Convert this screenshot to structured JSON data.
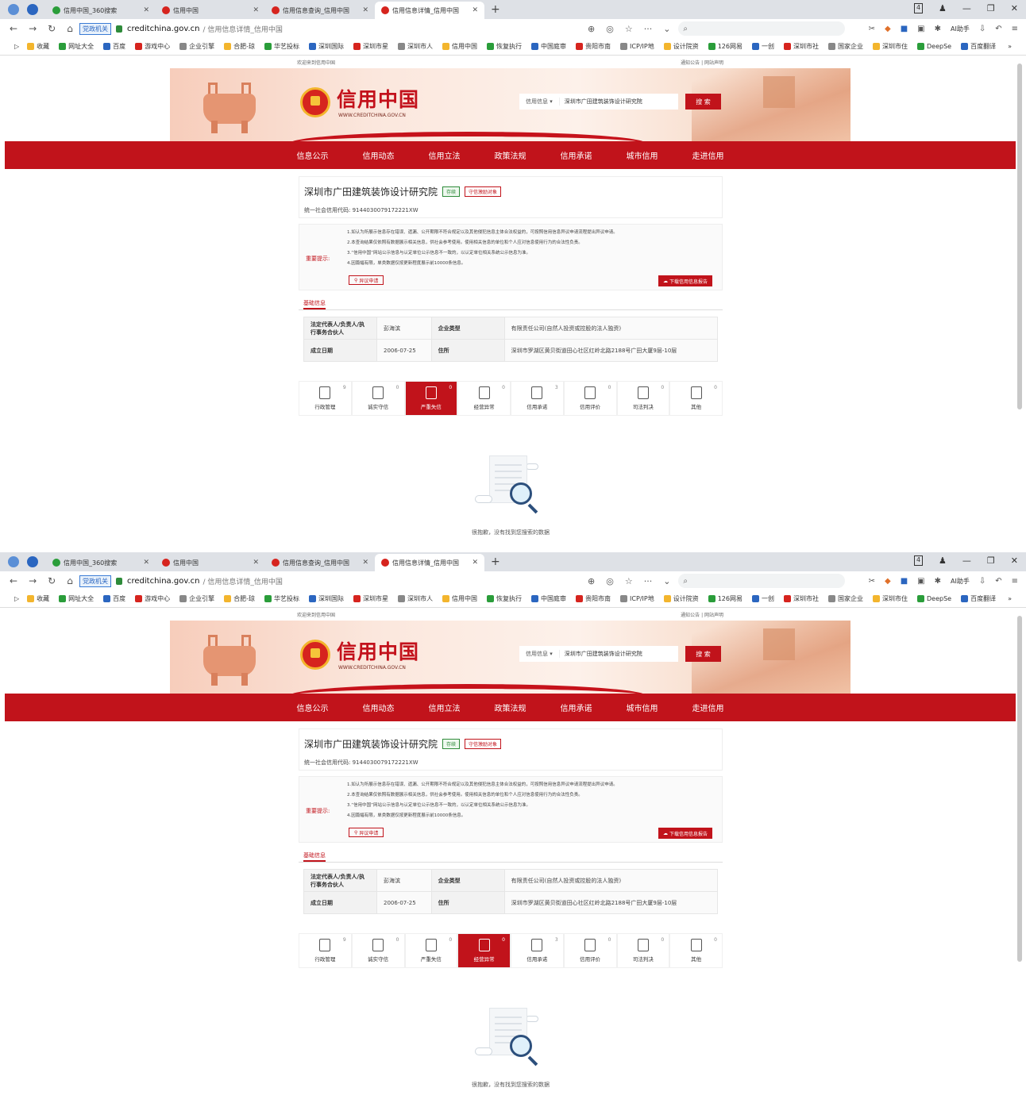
{
  "browser": {
    "tabs": [
      {
        "label": "信用中国_360搜索",
        "icon_color": "#2a9d3a",
        "active": false
      },
      {
        "label": "信用中国",
        "icon_color": "#d6241e",
        "active": false
      },
      {
        "label": "信用信息查询_信用中国",
        "icon_color": "#d6241e",
        "active": false
      },
      {
        "label": "信用信息详情_信用中国",
        "icon_color": "#d6241e",
        "active": true
      }
    ],
    "new_tab": "+",
    "tab_count_badge": "4",
    "address": {
      "badge": "党政机关",
      "host": "creditchina.gov.cn",
      "path": "/ 信用信息详情_信用中国"
    },
    "ai_assistant": "AI助手",
    "bookmarks": [
      "收藏",
      "网址大全",
      "百度",
      "游戏中心",
      "企业引擎",
      "合肥-琼",
      "华艺投标",
      "深圳国际",
      "深圳市星",
      "深圳市人",
      "信用中国",
      "恢复执行",
      "中国庭审",
      "贵阳市南",
      "ICP/IP地",
      "设计院资",
      "126网易",
      "一创",
      "深圳市社",
      "国家企业",
      "深圳市住",
      "DeepSe",
      "百度翻译"
    ],
    "bookmark_more": "»"
  },
  "site": {
    "top_left": "欢迎来到信用中国",
    "top_right": "通知公告  |  网站声明",
    "logo_cn": "信用中国",
    "logo_en": "WWW.CREDITCHINA.GOV.CN",
    "search_select": "信用信息 ▾",
    "search_value": "深圳市广田建筑装饰设计研究院",
    "search_button": "搜 索",
    "nav": [
      "信息公示",
      "信用动态",
      "信用立法",
      "政策法规",
      "信用承诺",
      "城市信用",
      "走进信用"
    ]
  },
  "company": {
    "name": "深圳市广田建筑装饰设计研究院",
    "tag_status": "存续",
    "tag_object": "守信激励对象",
    "credit_code_label": "统一社会信用代码:",
    "credit_code": "9144030079172221XW"
  },
  "notice": {
    "label": "重要提示:",
    "lines": [
      "1.如认为所展示信息存在错误、遗漏、公开期限不符合规定以及其他侵犯信息主体合法权益的，可按照信用信息异议申请流程提出异议申请。",
      "2.本查询结果仅依照有数据展示相关信息，供社会参考使用。使用相关信息的单位和个人应对信息使用行为的合法性负责。",
      "3.“信用中国”网站公示信息与认定单位公示信息不一致的，以认定单位相关系统公示信息为准。",
      "4.因篇幅有限，单类数据仅按更新程度展示前10000条信息。"
    ],
    "objection_button": "异议申请",
    "download_button": "下载信用信息报告"
  },
  "basic": {
    "title": "基础信息",
    "rows": [
      {
        "k1": "法定代表人/负责人/执行事务合伙人",
        "v1": "彭海滨",
        "k2": "企业类型",
        "v2": "有限责任公司(自然人投资或控股的法人独资)"
      },
      {
        "k1": "成立日期",
        "v1": "2006-07-25",
        "k2": "住所",
        "v2": "深圳市罗湖区黄贝街道田心社区红岭北路2188号广田大厦9层-10层"
      }
    ]
  },
  "categories": [
    {
      "label": "行政管理",
      "count": "9"
    },
    {
      "label": "诚实守信",
      "count": "0"
    },
    {
      "label": "严重失信",
      "count": "0"
    },
    {
      "label": "经营异常",
      "count": "0"
    },
    {
      "label": "信用承诺",
      "count": "3"
    },
    {
      "label": "信用评价",
      "count": "0"
    },
    {
      "label": "司法判决",
      "count": "0"
    },
    {
      "label": "其他",
      "count": "0"
    }
  ],
  "shots": [
    {
      "active_category": "严重失信"
    },
    {
      "active_category": "经营异常"
    }
  ],
  "empty_text": "很抱歉，没有找到您搜索的数据",
  "colors": {
    "brand_red": "#c1131b",
    "tab_bar": "#dee1e6"
  }
}
